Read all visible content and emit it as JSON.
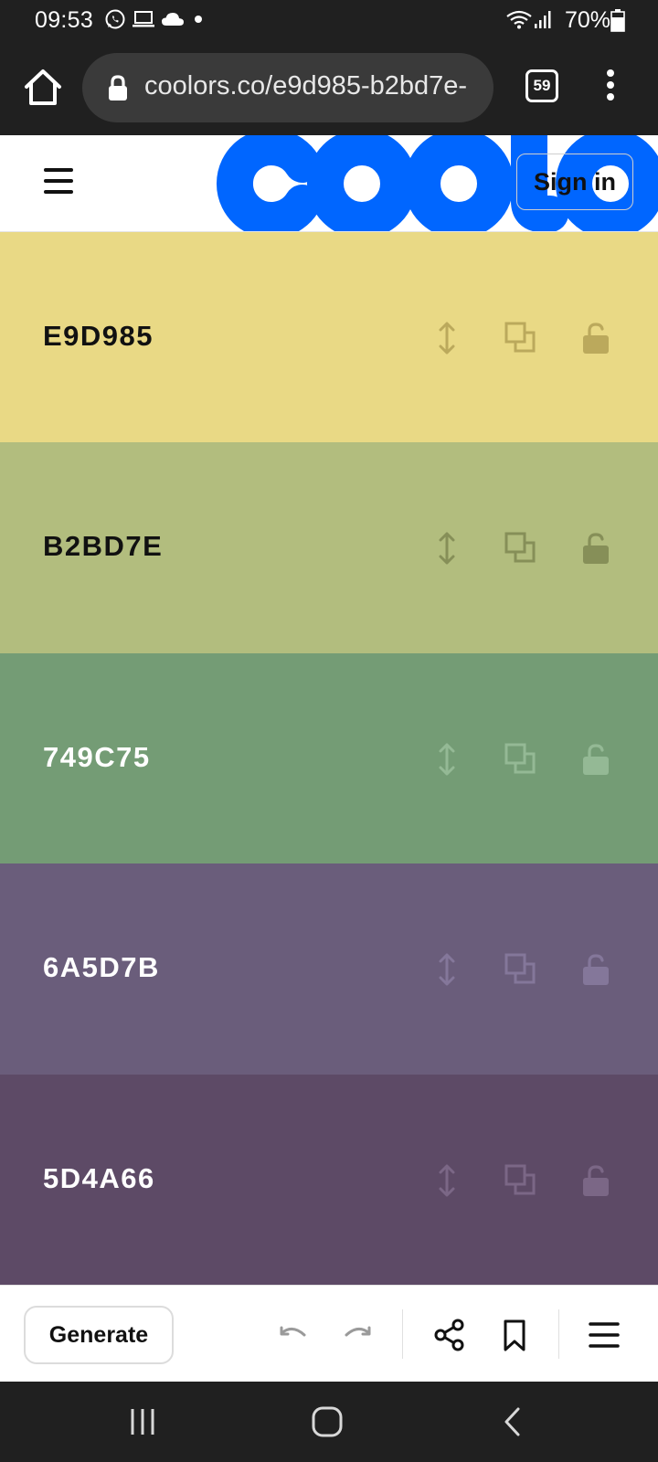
{
  "status_bar": {
    "time": "09:53",
    "icons": [
      "whatsapp-icon",
      "laptop-icon",
      "cloud-icon",
      "dot-icon"
    ],
    "right_icons": [
      "wifi-icon",
      "signal-icon",
      "battery-icon"
    ],
    "battery": "70%"
  },
  "browser": {
    "url": "coolors.co/e9d985-b2bd7e-",
    "tab_count": "59",
    "home_icon": "home-icon",
    "menu_icon": "kebab-menu-icon"
  },
  "header": {
    "menu_icon": "hamburger-icon",
    "logo_text": "coolors",
    "signin_label": "Sign in",
    "logo_color": "#0066ff"
  },
  "palette": {
    "colors": [
      {
        "hex": "E9D985",
        "bg": "#e9d985",
        "text_color": "#111111",
        "icon_color": "#bba95c"
      },
      {
        "hex": "B2BD7E",
        "bg": "#b2bd7e",
        "text_color": "#111111",
        "icon_color": "#868f58"
      },
      {
        "hex": "749C75",
        "bg": "#749c75",
        "text_color": "#ffffff",
        "icon_color": "#94b995"
      },
      {
        "hex": "6A5D7B",
        "bg": "#6a5d7b",
        "text_color": "#ffffff",
        "icon_color": "#84779a"
      },
      {
        "hex": "5D4A66",
        "bg": "#5d4a66",
        "text_color": "#ffffff",
        "icon_color": "#7b6786"
      }
    ],
    "tool_icons": [
      "drag-icon",
      "copy-icon",
      "unlock-icon"
    ]
  },
  "toolbar": {
    "generate_label": "Generate",
    "icons": [
      "undo-icon",
      "redo-icon",
      "share-icon",
      "bookmark-icon",
      "menu-icon"
    ]
  },
  "nav": {
    "icons": [
      "recent-apps-icon",
      "home-button-icon",
      "back-icon"
    ]
  }
}
